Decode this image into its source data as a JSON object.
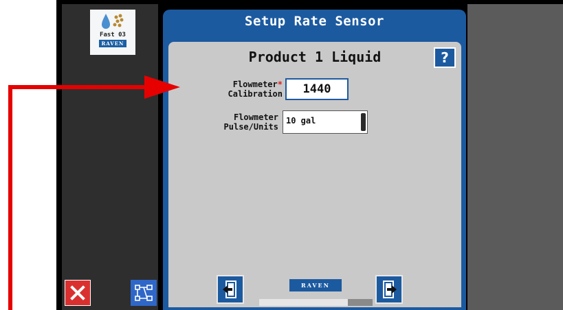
{
  "sidebar": {
    "logo": {
      "product": "Fast 03",
      "brand": "RAVEN"
    },
    "close_icon": "close-icon",
    "tree_icon": "tree-structure-icon"
  },
  "dialog": {
    "title": "Setup Rate Sensor",
    "product": "Product 1 Liquid",
    "help_label": "?",
    "fields": {
      "calibration": {
        "label_line1": "Flowmeter",
        "label_line2": "Calibration",
        "required_mark": "*",
        "value": "1440"
      },
      "pulse_units": {
        "label_line1": "Flowmeter",
        "label_line2": "Pulse/Units",
        "value": "10 gal"
      }
    },
    "footer": {
      "brand": "RAVEN",
      "progress": 0.78,
      "back_icon": "back-page-icon",
      "next_icon": "next-page-icon"
    }
  },
  "colors": {
    "accent": "#1c5aa0",
    "close": "#d9302f",
    "annotation_arrow": "#e60000"
  }
}
